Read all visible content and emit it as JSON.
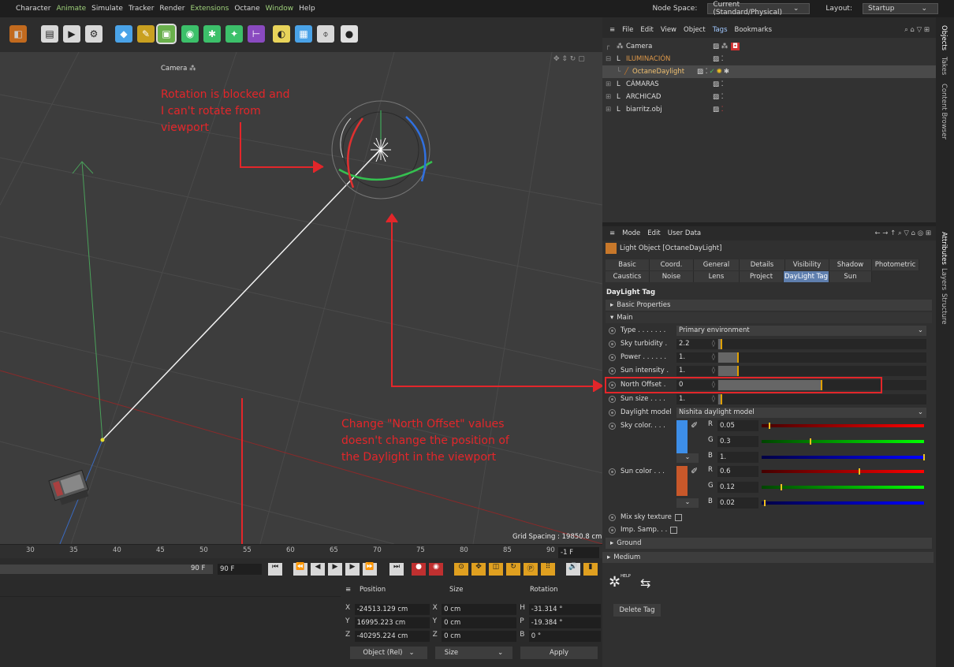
{
  "menubar": {
    "items": [
      "Character",
      "Animate",
      "Simulate",
      "Tracker",
      "Render",
      "Extensions",
      "Octane",
      "Window",
      "Help"
    ],
    "node_space_label": "Node Space:",
    "node_space_value": "Current (Standard/Physical)",
    "layout_label": "Layout:",
    "layout_value": "Startup"
  },
  "viewport": {
    "camera_label": "Camera",
    "grid_spacing": "Grid Spacing : 19850.8 cm",
    "annotation_1": [
      "Rotation is blocked and",
      "I can't rotate from",
      "viewport"
    ],
    "annotation_2": [
      "Change \"North Offset\" values",
      "doesn't change the position of",
      "the Daylight in the viewport"
    ]
  },
  "timeline": {
    "ticks": [
      "30",
      "35",
      "40",
      "45",
      "50",
      "55",
      "60",
      "65",
      "70",
      "75",
      "80",
      "85",
      "90"
    ],
    "current_frame": "-1 F",
    "end_frame_a": "90 F",
    "end_frame_b": "90 F"
  },
  "coords": {
    "header_position": "Position",
    "header_size": "Size",
    "header_rotation": "Rotation",
    "rows": [
      {
        "axis": "X",
        "pos": "-24513.129 cm",
        "size_axis": "X",
        "size": "0 cm",
        "rot_axis": "H",
        "rot": "-31.314 °"
      },
      {
        "axis": "Y",
        "pos": "16995.223 cm",
        "size_axis": "Y",
        "size": "0 cm",
        "rot_axis": "P",
        "rot": "-19.384 °"
      },
      {
        "axis": "Z",
        "pos": "-40295.224 cm",
        "size_axis": "Z",
        "size": "0 cm",
        "rot_axis": "B",
        "rot": "0 °"
      }
    ],
    "mode_select": "Object (Rel)",
    "size_select": "Size",
    "apply_label": "Apply"
  },
  "objects": {
    "menu": [
      "File",
      "Edit",
      "View",
      "Object",
      "Tags",
      "Bookmarks"
    ],
    "rows": [
      {
        "name": "Camera",
        "color": "#dddddd",
        "indent": 0
      },
      {
        "name": "ILUMINACIÓN",
        "color": "#e09a4a",
        "indent": 0
      },
      {
        "name": "OctaneDaylight",
        "color": "#f0c070",
        "indent": 1
      },
      {
        "name": "CÁMARAS",
        "color": "#dddddd",
        "indent": 0
      },
      {
        "name": "ARCHICAD",
        "color": "#dddddd",
        "indent": 0
      },
      {
        "name": "biarritz.obj",
        "color": "#dddddd",
        "indent": 0
      }
    ]
  },
  "attributes": {
    "menu": [
      "Mode",
      "Edit",
      "User Data"
    ],
    "object_title": "Light Object [OctaneDayLight]",
    "tabs_row1": [
      "Basic",
      "Coord.",
      "General",
      "Details",
      "Visibility",
      "Shadow",
      "Photometric"
    ],
    "tabs_row2": [
      "Caustics",
      "Noise",
      "Lens",
      "Project",
      "DayLight Tag",
      "Sun"
    ],
    "section_title": "DayLight Tag",
    "group_basic": "Basic Properties",
    "group_main": "Main",
    "type_label": "Type . . . . . . .",
    "type_value": "Primary environment",
    "sky_turbidity_label": "Sky turbidity .",
    "sky_turbidity_value": "2.2",
    "sky_turbidity_fill": 0.02,
    "power_label": "Power . . . . . .",
    "power_value": "1.",
    "power_fill": 0.1,
    "sun_intensity_label": "Sun intensity .",
    "sun_intensity_value": "1.",
    "sun_intensity_fill": 0.1,
    "north_offset_label": "North Offset .",
    "north_offset_value": "0",
    "north_offset_fill": 0.5,
    "sun_size_label": "Sun size . . . .",
    "sun_size_value": "1.",
    "sun_size_fill": 0.02,
    "daylight_model_label": "Daylight model",
    "daylight_model_value": "Nishita daylight model",
    "sky_color_label": "Sky color. . . .",
    "sky_color": {
      "r": "0.05",
      "g": "0.3",
      "b": "1.",
      "r_fill": 0.05,
      "g_fill": 0.3,
      "b_fill": 1.0,
      "swatch": "#3d8ee8"
    },
    "sun_color_label": "Sun color . . .",
    "sun_color": {
      "r": "0.6",
      "g": "0.12",
      "b": "0.02",
      "r_fill": 0.6,
      "g_fill": 0.12,
      "b_fill": 0.02,
      "swatch": "#c8582a"
    },
    "mix_sky_label": "Mix sky texture",
    "imp_samp_label": "Imp. Samp. . .",
    "group_ground": "Ground",
    "group_medium": "Medium",
    "delete_tag_label": "Delete Tag",
    "help_label": "HELP"
  },
  "side_tabs": [
    "Objects",
    "Takes",
    "Content Browser",
    "Attributes",
    "Layers",
    "Structure"
  ],
  "colors": {
    "accent": "#5f7fae",
    "annotation": "#e3262a"
  }
}
